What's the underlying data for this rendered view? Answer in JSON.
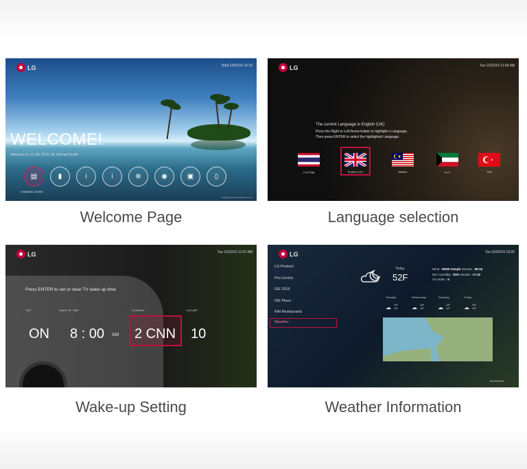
{
  "cards": [
    {
      "caption": "Welcome Page",
      "logo": "LG",
      "clock": "Wed 24/02/16 15:32",
      "welcome_title": "WELCOME!",
      "welcome_subtitle": "Welcome to LG ISE 2016, Mr. Richard Smith",
      "icons": [
        {
          "icon": "tv-guide-icon",
          "glyph": "▤"
        },
        {
          "icon": "calendar-icon",
          "glyph": "▮"
        },
        {
          "icon": "info-icon",
          "glyph": "i"
        },
        {
          "icon": "info-icon",
          "glyph": "i"
        },
        {
          "icon": "globe-icon",
          "glyph": "⊕"
        },
        {
          "icon": "alarm-clock-icon",
          "glyph": "◉"
        },
        {
          "icon": "tv-icon",
          "glyph": "▣"
        },
        {
          "icon": "remote-icon",
          "glyph": "▯"
        }
      ],
      "selected_icon_label": "CHANNEL GUIDE",
      "footer": "Copyright 2016 LG Electronics Inc."
    },
    {
      "caption": "Language selection",
      "logo": "LG",
      "clock": "Tue 12/22/15 11:06 AM",
      "prompt_title": "The current Language is English (UK)",
      "prompt_line1": "Press the Right or Left Arrow button to highlight a Language,",
      "prompt_line2": "Then press ENTER to select the highlighted Language.",
      "languages": [
        "ภาษาไทย",
        "English (UK)",
        "Malayu",
        "عربية",
        "Türk"
      ]
    },
    {
      "caption": "Wake-up Setting",
      "logo": "LG",
      "clock": "Tue 12/22/15 11:07 AM",
      "instruction": "Press ENTER to set or clear TV wake up time.",
      "labels": {
        "set": "SET",
        "wake_time": "WAKE UP TIME",
        "channel": "CHANNEL",
        "volume": "VOLUME"
      },
      "values": {
        "set": "ON",
        "time": "8 : 00",
        "ampm": "AM",
        "channel": "2 CNN",
        "volume": "10"
      }
    },
    {
      "caption": "Weather Information",
      "logo": "LG",
      "clock": "Tue 02/02/16 13:00",
      "menu": [
        "LG Product",
        "Pro:Centric",
        "ISE 2016",
        "ISE Place",
        "RAI Restaurants"
      ],
      "menu_selected": "Weather",
      "today_label": "Today",
      "temperature": "52F",
      "wind_label": "Wind",
      "wind_value": "WSW 23mph",
      "sunrise_label": "Sunrise",
      "sunrise_value": "08:16",
      "humidity_label": "Rel. Humidity",
      "humidity_value": "81%",
      "sunset_label": "Sunset",
      "sunset_value": "17:32",
      "uv_label": "UV Index",
      "uv_value": "5",
      "forecast": [
        {
          "day": "Tuesday",
          "hi": "43F",
          "lo": "40F"
        },
        {
          "day": "Wednesday",
          "hi": "46F",
          "lo": "40F"
        },
        {
          "day": "Thursday",
          "hi": "46F",
          "lo": "42F"
        },
        {
          "day": "Friday",
          "hi": "45F",
          "lo": "40F"
        }
      ],
      "location": "Amsterdam"
    }
  ]
}
